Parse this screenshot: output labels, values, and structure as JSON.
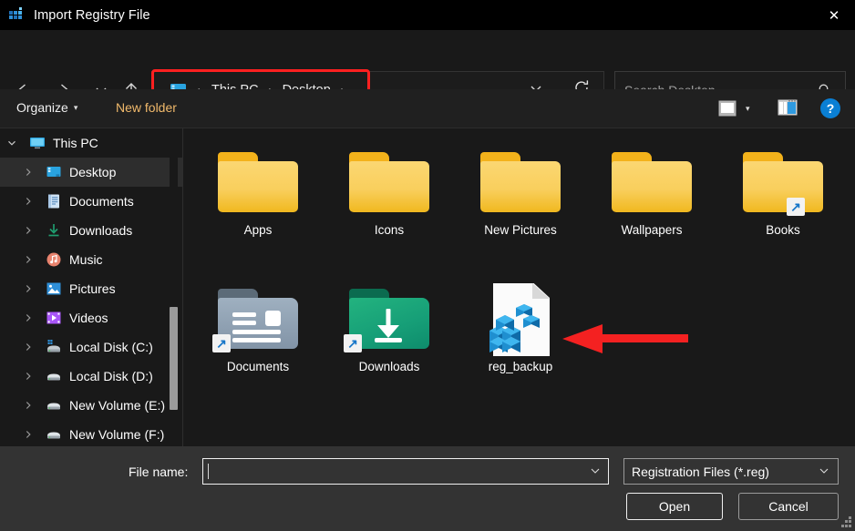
{
  "window": {
    "title": "Import Registry File",
    "title_icon": "registry-icon",
    "close_label": "✕"
  },
  "nav": {
    "back_icon": "arrow-left-icon",
    "forward_icon": "arrow-right-icon",
    "recent_icon": "chevron-down-icon",
    "up_icon": "arrow-up-icon",
    "address": {
      "root_icon": "this-pc-icon",
      "crumbs": [
        "This PC",
        "Desktop"
      ],
      "separator": "›",
      "trailing_separator": "›",
      "dropdown_icon": "chevron-down-icon",
      "refresh_icon": "refresh-icon",
      "highlight_color": "#ff2020"
    },
    "search": {
      "placeholder": "Search Desktop",
      "icon": "search-icon"
    }
  },
  "commandbar": {
    "organize_label": "Organize",
    "organize_caret": "▾",
    "new_folder_label": "New folder",
    "new_folder_color": "#f0b96b",
    "view_icon": "view-mode-icon",
    "view_caret": "▾",
    "pane_icon": "preview-pane-icon",
    "help_label": "?",
    "help_color": "#0a7fd4"
  },
  "sidebar": {
    "items": [
      {
        "label": "This PC",
        "icon": "monitor-icon",
        "expanded": true,
        "indent": 0,
        "selected": false
      },
      {
        "label": "Desktop",
        "icon": "desktop-icon",
        "expanded": false,
        "indent": 1,
        "selected": true
      },
      {
        "label": "Documents",
        "icon": "documents-icon",
        "expanded": false,
        "indent": 1,
        "selected": false
      },
      {
        "label": "Downloads",
        "icon": "downloads-icon",
        "expanded": false,
        "indent": 1,
        "selected": false
      },
      {
        "label": "Music",
        "icon": "music-icon",
        "expanded": false,
        "indent": 1,
        "selected": false
      },
      {
        "label": "Pictures",
        "icon": "pictures-icon",
        "expanded": false,
        "indent": 1,
        "selected": false
      },
      {
        "label": "Videos",
        "icon": "videos-icon",
        "expanded": false,
        "indent": 1,
        "selected": false
      },
      {
        "label": "Local Disk (C:)",
        "icon": "system-drive-icon",
        "expanded": false,
        "indent": 1,
        "selected": false
      },
      {
        "label": "Local Disk (D:)",
        "icon": "drive-icon",
        "expanded": false,
        "indent": 1,
        "selected": false
      },
      {
        "label": "New Volume (E:)",
        "icon": "drive-icon",
        "expanded": false,
        "indent": 1,
        "selected": false
      },
      {
        "label": "New Volume (F:)",
        "icon": "drive-icon",
        "expanded": false,
        "indent": 1,
        "selected": false
      }
    ]
  },
  "files": [
    {
      "name": "Apps",
      "icon": "folder-icon",
      "shortcut": false
    },
    {
      "name": "Icons",
      "icon": "folder-icon",
      "shortcut": false
    },
    {
      "name": "New Pictures",
      "icon": "folder-icon",
      "shortcut": false
    },
    {
      "name": "Wallpapers",
      "icon": "folder-icon",
      "shortcut": false
    },
    {
      "name": "Books",
      "icon": "folder-icon",
      "shortcut": true
    },
    {
      "name": "Documents",
      "icon": "documents-folder-icon",
      "shortcut": true
    },
    {
      "name": "Downloads",
      "icon": "downloads-folder-icon",
      "shortcut": true
    },
    {
      "name": "reg_backup",
      "icon": "registry-file-icon",
      "shortcut": false
    }
  ],
  "annotation": {
    "arrow_color": "#f42121",
    "points_to": "reg_backup"
  },
  "footer": {
    "filename_label": "File name:",
    "filename_value": "",
    "filename_dropdown_icon": "chevron-down-icon",
    "filter_value": "Registration Files (*.reg)",
    "filter_dropdown_icon": "chevron-down-icon",
    "open_label": "Open",
    "cancel_label": "Cancel",
    "resize_grip": "resize-grip-icon"
  }
}
